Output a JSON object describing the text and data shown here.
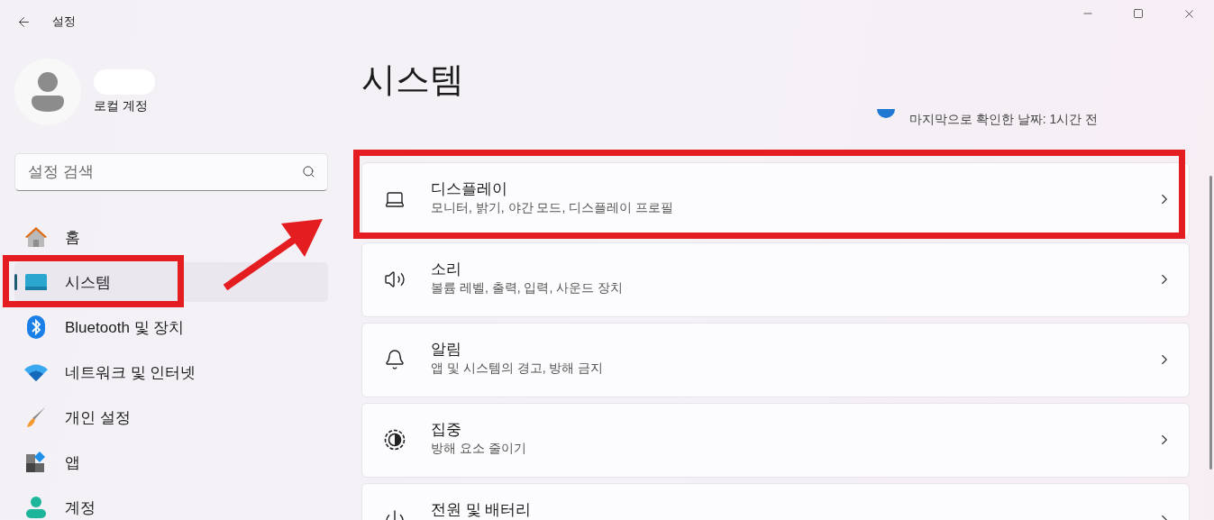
{
  "window": {
    "title": "설정",
    "controls": [
      {
        "kind": "minimize"
      },
      {
        "kind": "maximize"
      },
      {
        "kind": "close"
      }
    ]
  },
  "profile": {
    "account_type": "로컬 계정"
  },
  "search": {
    "placeholder": "설정 검색"
  },
  "sidebar": {
    "items": [
      {
        "label": "홈",
        "kind": "home",
        "selected": false
      },
      {
        "label": "시스템",
        "kind": "system",
        "selected": true
      },
      {
        "label": "Bluetooth 및 장치",
        "kind": "bluetooth",
        "selected": false
      },
      {
        "label": "네트워크 및 인터넷",
        "kind": "network",
        "selected": false
      },
      {
        "label": "개인 설정",
        "kind": "personalize",
        "selected": false
      },
      {
        "label": "앱",
        "kind": "apps",
        "selected": false
      },
      {
        "label": "계정",
        "kind": "accounts",
        "selected": false
      }
    ]
  },
  "page": {
    "title": "시스템",
    "status": "마지막으로 확인한 날짜: 1시간 전"
  },
  "cards": [
    {
      "kind": "display",
      "title": "디스플레이",
      "subtitle": "모니터, 밝기, 야간 모드, 디스플레이 프로필"
    },
    {
      "kind": "sound",
      "title": "소리",
      "subtitle": "볼륨 레벨, 출력, 입력, 사운드 장치"
    },
    {
      "kind": "notifications",
      "title": "알림",
      "subtitle": "앱 및 시스템의 경고, 방해 금지"
    },
    {
      "kind": "focus",
      "title": "집중",
      "subtitle": "방해 요소 줄이기"
    },
    {
      "kind": "power",
      "title": "전원 및 배터리"
    }
  ],
  "annotations": [
    {
      "kind": "box"
    },
    {
      "kind": "box"
    },
    {
      "kind": "arrow"
    }
  ]
}
